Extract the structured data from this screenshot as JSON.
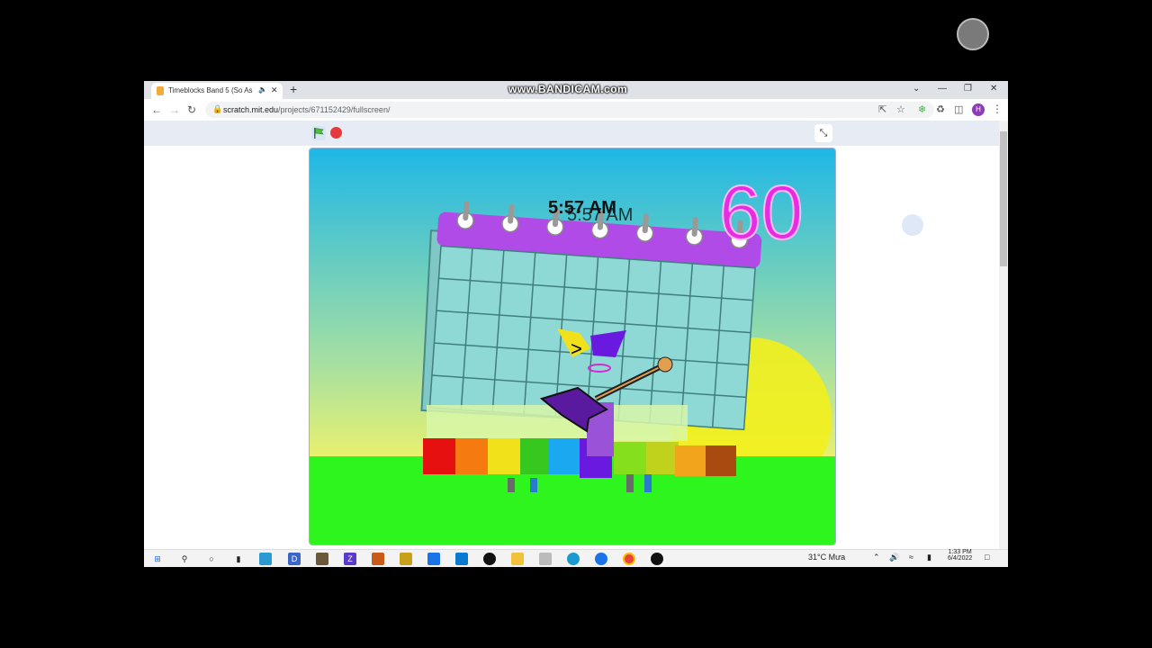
{
  "recorder": {
    "watermark": "www.BANDICAM.com"
  },
  "browser": {
    "tab": {
      "title": "Timeblocks Band 5 (So As Th",
      "audio_icon": "speaker-icon",
      "close_label": "✕"
    },
    "new_tab_label": "+",
    "window_controls": {
      "chevron": "⌄",
      "minimize": "—",
      "restore": "❐",
      "close": "✕"
    },
    "nav": {
      "back": "←",
      "forward": "→",
      "reload": "↻"
    },
    "url": {
      "host": "scratch.mit.edu",
      "path": "/projects/671152429/fullscreen/"
    },
    "profile_initial": "H",
    "menu": "⋮"
  },
  "scratch": {
    "green_flag": "green-flag-icon",
    "stop": "stop-sign-icon",
    "exit_fullscreen": "⤡",
    "stage": {
      "clock_label": "5:57 AM",
      "counter": "60",
      "colors": {
        "sky_top": "#1fb7e6",
        "sky_bottom": "#e7f36a",
        "grass": "#2ef51e",
        "sun": "#f2ef1c",
        "calendar_header": "#b14be8",
        "calendar_cell": "#8ed8d6",
        "counter": "#e62ee0"
      }
    }
  },
  "taskbar": {
    "weather": "31°C  Mưa",
    "time": "1:33 PM",
    "date": "6/4/2022"
  }
}
